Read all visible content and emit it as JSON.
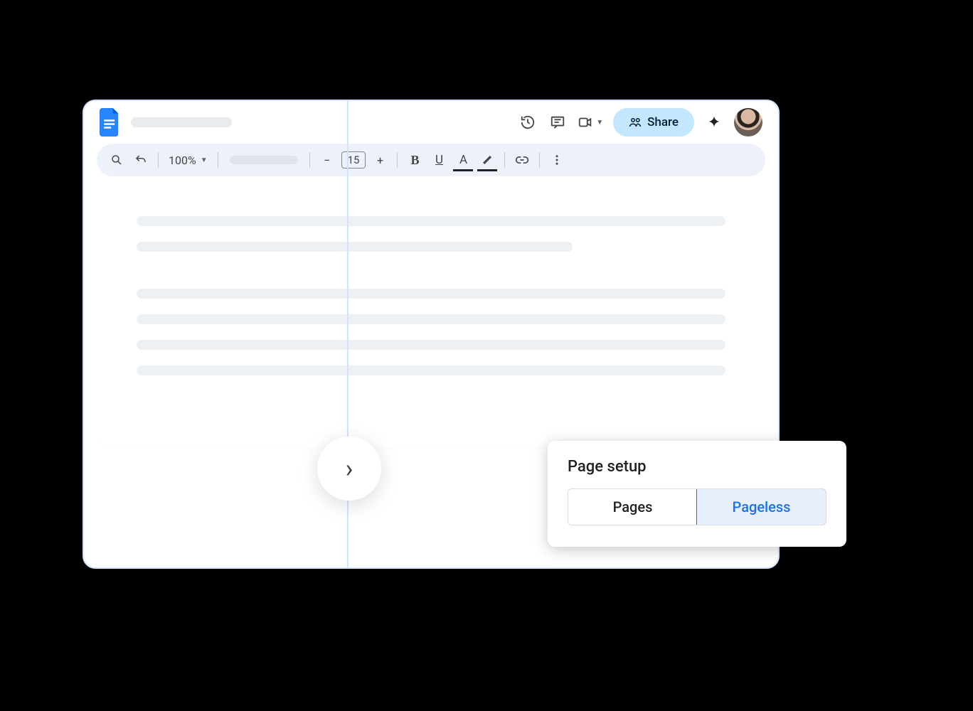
{
  "header": {
    "share_label": "Share"
  },
  "toolbar": {
    "zoom": "100%",
    "font_size": "15",
    "minus": "−",
    "plus": "+",
    "bold": "B",
    "underline": "U",
    "textcolor": "A"
  },
  "popup": {
    "title": "Page setup",
    "options": [
      "Pages",
      "Pageless"
    ],
    "selected_index": 1
  }
}
